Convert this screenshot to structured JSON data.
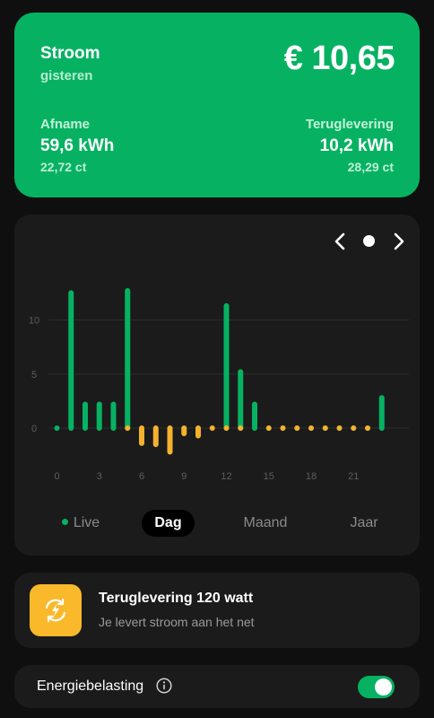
{
  "summary": {
    "title": "Stroom",
    "subtitle": "gisteren",
    "amount": "€ 10,65",
    "afname": {
      "label": "Afname",
      "value": "59,6 kWh",
      "price": "22,72 ct"
    },
    "teruglevering": {
      "label": "Teruglevering",
      "value": "10,2 kWh",
      "price": "28,29 ct"
    }
  },
  "chart_nav": {
    "prev_icon": "chevron-left-icon",
    "current_icon": "dot-icon",
    "next_icon": "chevron-right-icon"
  },
  "chart_data": {
    "type": "bar",
    "categories": [
      "0",
      "1",
      "2",
      "3",
      "4",
      "5",
      "6",
      "7",
      "8",
      "9",
      "10",
      "11",
      "12",
      "13",
      "14",
      "15",
      "16",
      "17",
      "18",
      "19",
      "20",
      "21",
      "22",
      "23"
    ],
    "series": [
      {
        "values": [
          0.15,
          13.0,
          2.7,
          2.7,
          2.7,
          13.2,
          0,
          0,
          0,
          0,
          0,
          0,
          11.8,
          5.7,
          2.7,
          0.3,
          0.15,
          0.15,
          0.15,
          0.15,
          0.15,
          0.15,
          0.3,
          3.3
        ]
      },
      {
        "values": [
          0,
          0,
          0,
          0,
          0,
          -0.2,
          -1.9,
          -2.0,
          -2.7,
          -1.0,
          -1.2,
          -0.2,
          -0.2,
          -0.2,
          0,
          -0.2,
          -0.2,
          -0.2,
          -0.2,
          -0.2,
          -0.2,
          -0.2,
          -0.2,
          0
        ]
      }
    ],
    "y_ticks": [
      "10",
      "5",
      "0"
    ],
    "x_ticks": [
      "0",
      "3",
      "6",
      "9",
      "12",
      "15",
      "18",
      "21"
    ],
    "ylim": [
      -3.3,
      13.6
    ],
    "grid": true,
    "colors": {
      "positive": "#06b262",
      "negative": "#f4b22e",
      "grid": "#2d2d2d",
      "tick": "#5d5d5d"
    }
  },
  "tabs": {
    "live": "Live",
    "dag": "Dag",
    "maand": "Maand",
    "jaar": "Jaar"
  },
  "feed": {
    "icon": "energy-return-icon",
    "title": "Teruglevering 120 watt",
    "subtitle": "Je levert stroom aan het net"
  },
  "tax": {
    "label": "Energiebelasting",
    "info_icon": "info-icon",
    "toggle_on": true
  },
  "colors": {
    "brand": "#06b262",
    "accent": "#f9b92b",
    "background": "#0f0f0f",
    "card": "#1b1b1b"
  }
}
